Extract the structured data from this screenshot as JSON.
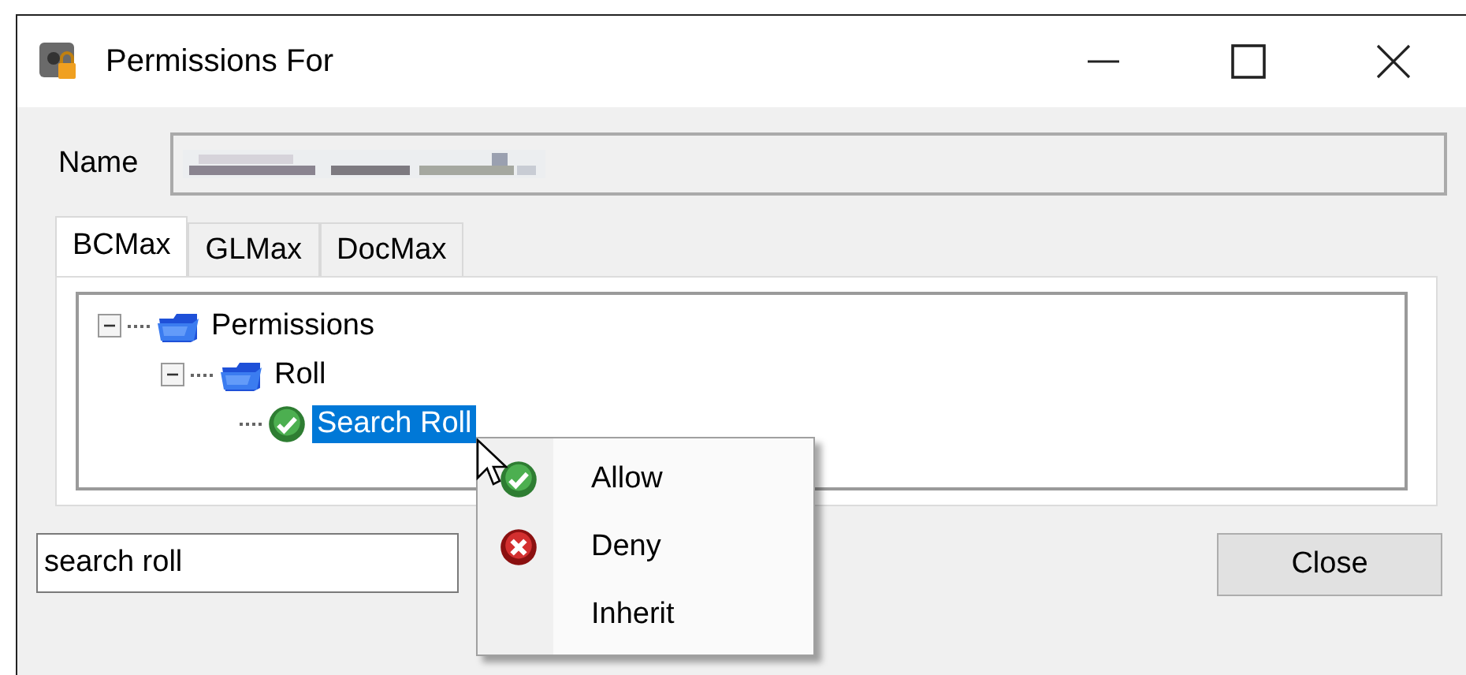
{
  "window": {
    "title": "Permissions For"
  },
  "name_field": {
    "label": "Name"
  },
  "tabs": [
    {
      "label": "BCMax",
      "selected": true
    },
    {
      "label": "GLMax",
      "selected": false
    },
    {
      "label": "DocMax",
      "selected": false
    }
  ],
  "tree": [
    {
      "label": "Permissions",
      "kind": "group",
      "expanded": true,
      "selected": false,
      "children": [
        {
          "label": "Roll",
          "kind": "group",
          "expanded": true,
          "selected": false,
          "children": [
            {
              "label": "Search Roll",
              "kind": "allowed",
              "selected": true
            }
          ]
        }
      ]
    }
  ],
  "search": {
    "value": "search roll"
  },
  "buttons": [
    {
      "label": "Close"
    }
  ],
  "context_menu": [
    {
      "label": "Allow",
      "kind": "allow"
    },
    {
      "label": "Deny",
      "kind": "deny"
    },
    {
      "label": "Inherit",
      "kind": "inherit"
    }
  ]
}
